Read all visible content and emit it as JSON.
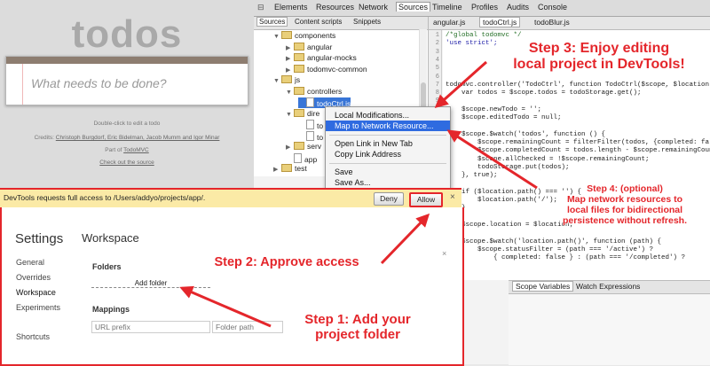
{
  "todo": {
    "title": "todos",
    "placeholder": "What needs to be done?",
    "hint": "Double-click to edit a todo",
    "credits_prefix": "Credits:",
    "credits_names": "Christoph Burgdorf, Eric Bidelman, Jacob Mumm and Igor Minar",
    "part_of_prefix": "Part of",
    "part_of_link": "TodoMVC",
    "check_source": "Check out the source"
  },
  "devtools": {
    "tabs": [
      "Elements",
      "Resources",
      "Network",
      "Sources",
      "Timeline",
      "Profiles",
      "Audits",
      "Console"
    ],
    "nav_tabs": [
      "Sources",
      "Content scripts",
      "Snippets"
    ],
    "tree": [
      {
        "label": "components",
        "type": "folder",
        "arrow": "▼"
      },
      {
        "label": "angular",
        "type": "folder",
        "arrow": "▶"
      },
      {
        "label": "angular-mocks",
        "type": "folder",
        "arrow": "▶"
      },
      {
        "label": "todomvc-common",
        "type": "folder",
        "arrow": "▶"
      },
      {
        "label": "js",
        "type": "folder",
        "arrow": "▼"
      },
      {
        "label": "controllers",
        "type": "folder",
        "arrow": "▼"
      },
      {
        "label": "todoCtrl.js",
        "type": "file",
        "arrow": ""
      },
      {
        "label": "dire",
        "type": "folder",
        "arrow": "▼"
      },
      {
        "label": "to",
        "type": "file",
        "arrow": ""
      },
      {
        "label": "to",
        "type": "file",
        "arrow": ""
      },
      {
        "label": "serv",
        "type": "folder",
        "arrow": "▶"
      },
      {
        "label": "app",
        "type": "file",
        "arrow": ""
      },
      {
        "label": "test",
        "type": "folder",
        "arrow": "▶"
      }
    ],
    "editor_tabs": [
      "angular.js",
      "todoCtrl.js",
      "todoBlur.js"
    ],
    "line_numbers": [
      "1",
      "2",
      "3",
      "4",
      "5",
      "6",
      "7",
      "8",
      "9",
      "10",
      "11",
      "12",
      "13",
      "14",
      "15",
      "16",
      "17",
      "18",
      "19",
      "20",
      "21",
      "22",
      "23",
      "24",
      "25",
      "26",
      "27",
      "28",
      "29",
      "30"
    ],
    "code_lines": [
      "/*global todomvc */",
      "'use strict';",
      "",
      "",
      "",
      "",
      "todomvc.controller('TodoCtrl', function TodoCtrl($scope, $location, t",
      "    var todos = $scope.todos = todoStorage.get();",
      "",
      "    $scope.newTodo = '';",
      "    $scope.editedTodo = null;",
      "",
      "    $scope.$watch('todos', function () {",
      "        $scope.remainingCount = filterFilter(todos, {completed: false",
      "        $scope.completedCount = todos.length - $scope.remainingCount;",
      "        $scope.allChecked = !$scope.remainingCount;",
      "        todoStorage.put(todos);",
      "    }, true);",
      "",
      "    if ($location.path() === '') {",
      "        $location.path('/');",
      "    }",
      "",
      "    $scope.location = $location;",
      "",
      "    $scope.$watch('location.path()', function (path) {",
      "        $scope.statusFilter = (path === '/active') ?",
      "            { completed: false } : (path === '/completed') ?"
    ],
    "bottom_tabs": [
      "Scope Variables",
      "Watch Expressions"
    ],
    "context_menu": {
      "items": [
        "Local Modifications...",
        "Map to Network Resource...",
        "Open Link in New Tab",
        "Copy Link Address",
        "Save",
        "Save As..."
      ]
    }
  },
  "infobar": {
    "message": "DevTools requests full access to /Users/addyo/projects/app/.",
    "deny": "Deny",
    "allow": "Allow",
    "close": "×"
  },
  "settings": {
    "title": "Settings",
    "nav": [
      "General",
      "Overrides",
      "Workspace",
      "Experiments",
      "Shortcuts"
    ],
    "panel_title": "Workspace",
    "close": "×",
    "folders_heading": "Folders",
    "add_folder": "Add folder",
    "mappings_heading": "Mappings",
    "url_prefix_placeholder": "URL prefix",
    "folder_path_placeholder": "Folder path"
  },
  "annotations": {
    "step1_line1": "Step 1: Add your",
    "step1_line2": "project folder",
    "step2": "Step 2: Approve access",
    "step3_line1": "Step 3: Enjoy editing",
    "step3_line2": "local project in DevTools!",
    "step4_line1": "Step 4: (optional)",
    "step4_line2": "Map network resources to",
    "step4_line3": "local files for bidirectional",
    "step4_line4": "persistence without refresh.",
    "color": "#e4262b"
  }
}
